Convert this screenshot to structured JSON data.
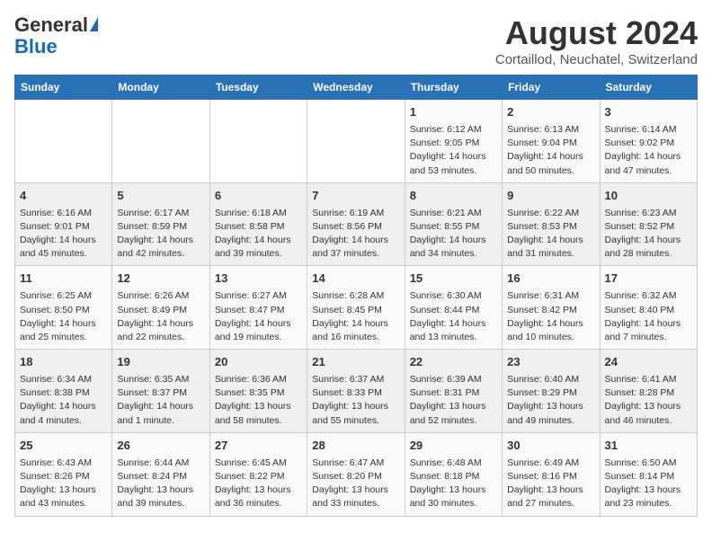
{
  "header": {
    "logo_line1": "General",
    "logo_line2": "Blue",
    "month": "August 2024",
    "location": "Cortaillod, Neuchatel, Switzerland"
  },
  "days_of_week": [
    "Sunday",
    "Monday",
    "Tuesday",
    "Wednesday",
    "Thursday",
    "Friday",
    "Saturday"
  ],
  "weeks": [
    [
      {
        "day": "",
        "info": ""
      },
      {
        "day": "",
        "info": ""
      },
      {
        "day": "",
        "info": ""
      },
      {
        "day": "",
        "info": ""
      },
      {
        "day": "1",
        "info": "Sunrise: 6:12 AM\nSunset: 9:05 PM\nDaylight: 14 hours and 53 minutes."
      },
      {
        "day": "2",
        "info": "Sunrise: 6:13 AM\nSunset: 9:04 PM\nDaylight: 14 hours and 50 minutes."
      },
      {
        "day": "3",
        "info": "Sunrise: 6:14 AM\nSunset: 9:02 PM\nDaylight: 14 hours and 47 minutes."
      }
    ],
    [
      {
        "day": "4",
        "info": "Sunrise: 6:16 AM\nSunset: 9:01 PM\nDaylight: 14 hours and 45 minutes."
      },
      {
        "day": "5",
        "info": "Sunrise: 6:17 AM\nSunset: 8:59 PM\nDaylight: 14 hours and 42 minutes."
      },
      {
        "day": "6",
        "info": "Sunrise: 6:18 AM\nSunset: 8:58 PM\nDaylight: 14 hours and 39 minutes."
      },
      {
        "day": "7",
        "info": "Sunrise: 6:19 AM\nSunset: 8:56 PM\nDaylight: 14 hours and 37 minutes."
      },
      {
        "day": "8",
        "info": "Sunrise: 6:21 AM\nSunset: 8:55 PM\nDaylight: 14 hours and 34 minutes."
      },
      {
        "day": "9",
        "info": "Sunrise: 6:22 AM\nSunset: 8:53 PM\nDaylight: 14 hours and 31 minutes."
      },
      {
        "day": "10",
        "info": "Sunrise: 6:23 AM\nSunset: 8:52 PM\nDaylight: 14 hours and 28 minutes."
      }
    ],
    [
      {
        "day": "11",
        "info": "Sunrise: 6:25 AM\nSunset: 8:50 PM\nDaylight: 14 hours and 25 minutes."
      },
      {
        "day": "12",
        "info": "Sunrise: 6:26 AM\nSunset: 8:49 PM\nDaylight: 14 hours and 22 minutes."
      },
      {
        "day": "13",
        "info": "Sunrise: 6:27 AM\nSunset: 8:47 PM\nDaylight: 14 hours and 19 minutes."
      },
      {
        "day": "14",
        "info": "Sunrise: 6:28 AM\nSunset: 8:45 PM\nDaylight: 14 hours and 16 minutes."
      },
      {
        "day": "15",
        "info": "Sunrise: 6:30 AM\nSunset: 8:44 PM\nDaylight: 14 hours and 13 minutes."
      },
      {
        "day": "16",
        "info": "Sunrise: 6:31 AM\nSunset: 8:42 PM\nDaylight: 14 hours and 10 minutes."
      },
      {
        "day": "17",
        "info": "Sunrise: 6:32 AM\nSunset: 8:40 PM\nDaylight: 14 hours and 7 minutes."
      }
    ],
    [
      {
        "day": "18",
        "info": "Sunrise: 6:34 AM\nSunset: 8:38 PM\nDaylight: 14 hours and 4 minutes."
      },
      {
        "day": "19",
        "info": "Sunrise: 6:35 AM\nSunset: 8:37 PM\nDaylight: 14 hours and 1 minute."
      },
      {
        "day": "20",
        "info": "Sunrise: 6:36 AM\nSunset: 8:35 PM\nDaylight: 13 hours and 58 minutes."
      },
      {
        "day": "21",
        "info": "Sunrise: 6:37 AM\nSunset: 8:33 PM\nDaylight: 13 hours and 55 minutes."
      },
      {
        "day": "22",
        "info": "Sunrise: 6:39 AM\nSunset: 8:31 PM\nDaylight: 13 hours and 52 minutes."
      },
      {
        "day": "23",
        "info": "Sunrise: 6:40 AM\nSunset: 8:29 PM\nDaylight: 13 hours and 49 minutes."
      },
      {
        "day": "24",
        "info": "Sunrise: 6:41 AM\nSunset: 8:28 PM\nDaylight: 13 hours and 46 minutes."
      }
    ],
    [
      {
        "day": "25",
        "info": "Sunrise: 6:43 AM\nSunset: 8:26 PM\nDaylight: 13 hours and 43 minutes."
      },
      {
        "day": "26",
        "info": "Sunrise: 6:44 AM\nSunset: 8:24 PM\nDaylight: 13 hours and 39 minutes."
      },
      {
        "day": "27",
        "info": "Sunrise: 6:45 AM\nSunset: 8:22 PM\nDaylight: 13 hours and 36 minutes."
      },
      {
        "day": "28",
        "info": "Sunrise: 6:47 AM\nSunset: 8:20 PM\nDaylight: 13 hours and 33 minutes."
      },
      {
        "day": "29",
        "info": "Sunrise: 6:48 AM\nSunset: 8:18 PM\nDaylight: 13 hours and 30 minutes."
      },
      {
        "day": "30",
        "info": "Sunrise: 6:49 AM\nSunset: 8:16 PM\nDaylight: 13 hours and 27 minutes."
      },
      {
        "day": "31",
        "info": "Sunrise: 6:50 AM\nSunset: 8:14 PM\nDaylight: 13 hours and 23 minutes."
      }
    ]
  ]
}
